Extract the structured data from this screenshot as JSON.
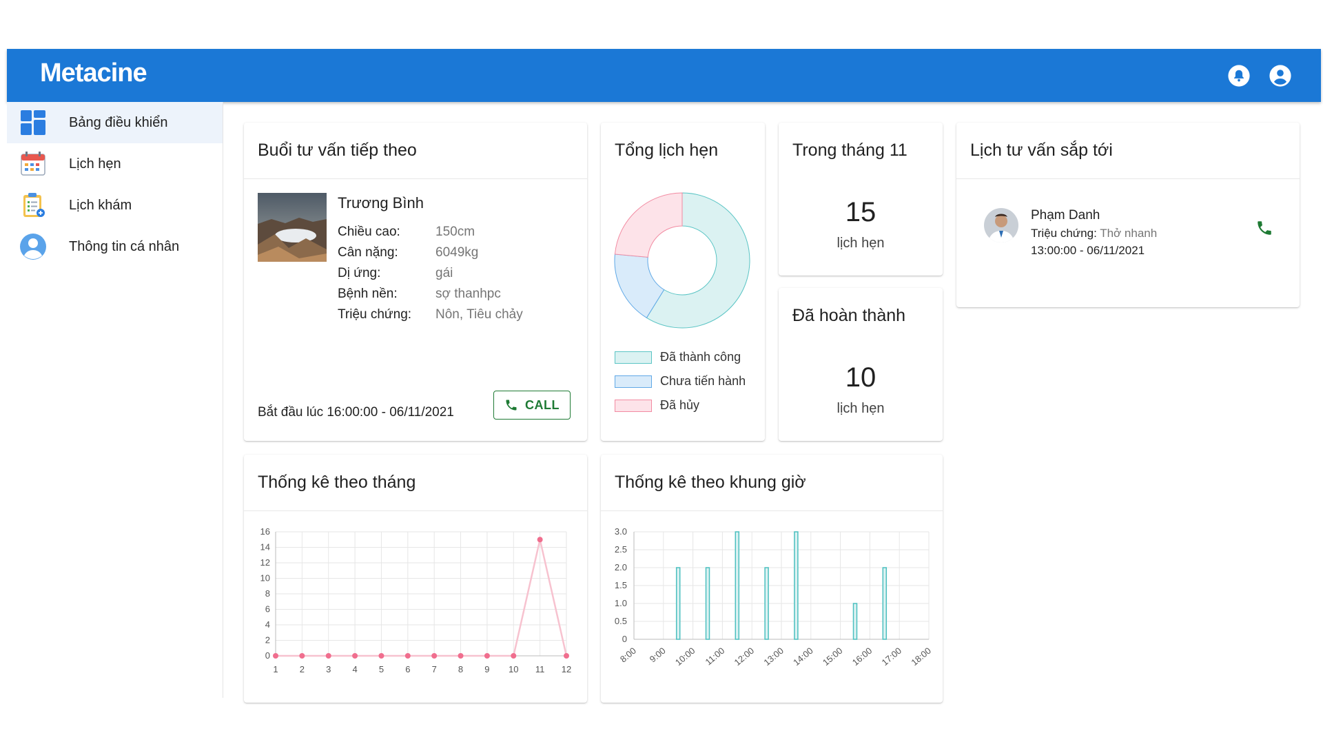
{
  "app": {
    "name": "Metacine"
  },
  "header": {
    "icons": [
      "bell-icon",
      "account-circle-icon"
    ]
  },
  "sidebar": {
    "items": [
      {
        "label": "Bảng điều khiển",
        "icon": "dashboard-icon",
        "active": true
      },
      {
        "label": "Lịch hẹn",
        "icon": "calendar-icon",
        "active": false
      },
      {
        "label": "Lịch khám",
        "icon": "clipboard-icon",
        "active": false
      },
      {
        "label": "Thông tin cá nhân",
        "icon": "user-icon",
        "active": false
      }
    ]
  },
  "next_session": {
    "title": "Buổi tư vấn tiếp theo",
    "patient_name": "Trương Bình",
    "fields": [
      {
        "label": "Chiều cao:",
        "value": "150cm"
      },
      {
        "label": "Cân nặng:",
        "value": "6049kg"
      },
      {
        "label": "Dị ứng:",
        "value": "gái"
      },
      {
        "label": "Bệnh nền:",
        "value": "sợ thanhpc"
      },
      {
        "label": "Triệu chứng:",
        "value": "Nôn, Tiêu chảy"
      }
    ],
    "start_text": "Bắt đầu lúc 16:00:00 - 06/11/2021",
    "call_label": "CALL"
  },
  "total_appointments": {
    "title": "Tổng lịch hẹn",
    "legend": [
      {
        "label": "Đã thành công",
        "color": "#dbf2f2",
        "border": "#59c4c4"
      },
      {
        "label": "Chưa tiến hành",
        "color": "#d9ebfa",
        "border": "#5fa8e6"
      },
      {
        "label": "Đã hủy",
        "color": "#fde3e9",
        "border": "#f28aa1"
      }
    ],
    "chart_data": {
      "type": "pie",
      "labels": [
        "Đã thành công",
        "Chưa tiến hành",
        "Đã hủy"
      ],
      "values": [
        10,
        3,
        4
      ]
    }
  },
  "month_stat": {
    "title": "Trong tháng 11",
    "value": "15",
    "unit": "lịch hẹn"
  },
  "completed_stat": {
    "title": "Đã hoàn thành",
    "value": "10",
    "unit": "lịch hẹn"
  },
  "upcoming": {
    "title": "Lịch tư vấn sắp tới",
    "items": [
      {
        "name": "Phạm Danh",
        "symptom_label": "Triệu chứng:",
        "symptom_value": "Thở nhanh",
        "time": "13:00:00 - 06/11/2021"
      }
    ]
  },
  "monthly_stats": {
    "title": "Thống kê theo tháng",
    "chart_data": {
      "type": "line",
      "x": [
        "1",
        "2",
        "3",
        "4",
        "5",
        "6",
        "7",
        "8",
        "9",
        "10",
        "11",
        "12"
      ],
      "series": [
        {
          "values": [
            0,
            0,
            0,
            0,
            0,
            0,
            0,
            0,
            0,
            0,
            15,
            0
          ],
          "color": "#f06e8e"
        }
      ],
      "ylim": [
        0,
        16
      ],
      "yticks": [
        "0",
        "2",
        "4",
        "6",
        "8",
        "10",
        "12",
        "14",
        "16"
      ],
      "grid": true
    }
  },
  "hourly_stats": {
    "title": "Thống kê theo khung giờ",
    "chart_data": {
      "type": "bar",
      "categories": [
        "8:00",
        "9:00",
        "10:00",
        "11:00",
        "12:00",
        "13:00",
        "14:00",
        "15:00",
        "16:00",
        "17:00",
        "18:00"
      ],
      "values": [
        0,
        2,
        2,
        3,
        2,
        3,
        0,
        1,
        2,
        0,
        0
      ],
      "ylim": [
        0,
        3
      ],
      "yticks": [
        "0",
        "0.5",
        "1.0",
        "1.5",
        "2.0",
        "2.5",
        "3.0"
      ],
      "color": "#4bbfbf",
      "grid": true
    }
  }
}
